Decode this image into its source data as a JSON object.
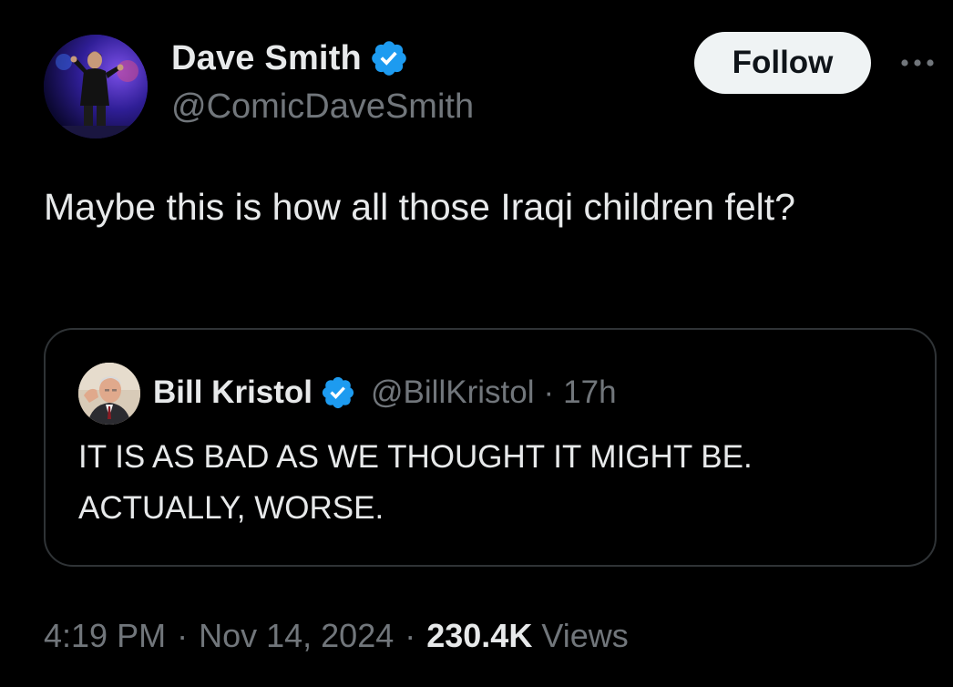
{
  "author": {
    "display_name": "Dave Smith",
    "handle": "@ComicDaveSmith",
    "verified": true,
    "avatar_icon": "comedian-on-stage-avatar"
  },
  "actions": {
    "follow_label": "Follow",
    "more_icon": "more-horizontal-icon"
  },
  "tweet": {
    "text": "Maybe this is how all those Iraqi children felt?"
  },
  "quoted": {
    "display_name": "Bill Kristol",
    "handle": "@BillKristol",
    "separator": "·",
    "time": "17h",
    "verified": true,
    "avatar_icon": "man-portrait-avatar",
    "text": "IT IS AS BAD AS WE THOUGHT IT MIGHT BE. ACTUALLY, WORSE."
  },
  "meta": {
    "time": "4:19 PM",
    "separator": "·",
    "date": "Nov 14, 2024",
    "views_count": "230.4K",
    "views_label": "Views"
  },
  "colors": {
    "background": "#000000",
    "primary_text": "#e7e9ea",
    "secondary_text": "#71767b",
    "verified_blue": "#1d9bf0",
    "border": "#2f3336",
    "follow_button_bg": "#eff3f4"
  }
}
